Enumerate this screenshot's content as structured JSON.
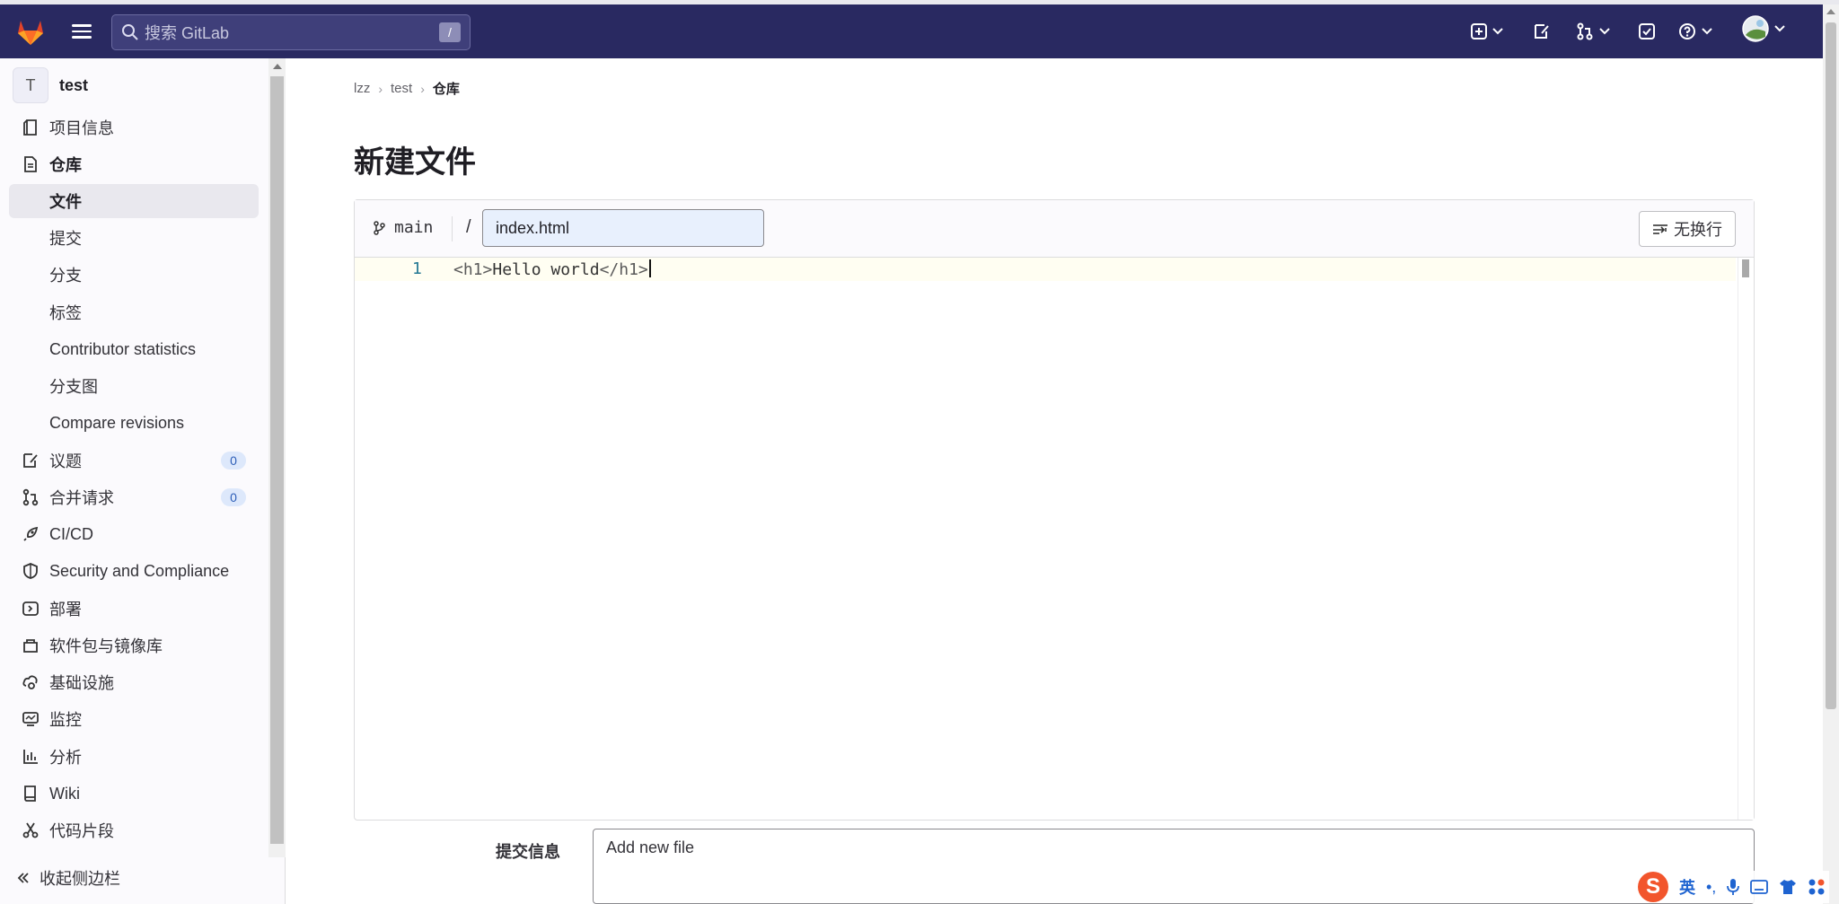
{
  "search": {
    "placeholder": "搜索 GitLab",
    "shortcut": "/"
  },
  "sidebar": {
    "project_avatar": "T",
    "project_name": "test",
    "items": [
      {
        "label": "项目信息",
        "icon": "project-info-icon"
      },
      {
        "label": "仓库",
        "icon": "document-icon"
      },
      {
        "label": "文件"
      },
      {
        "label": "提交"
      },
      {
        "label": "分支"
      },
      {
        "label": "标签"
      },
      {
        "label": "Contributor statistics"
      },
      {
        "label": "分支图"
      },
      {
        "label": "Compare revisions"
      },
      {
        "label": "议题",
        "icon": "issues-icon",
        "badge": "0"
      },
      {
        "label": "合并请求",
        "icon": "merge-request-icon",
        "badge": "0"
      },
      {
        "label": "CI/CD",
        "icon": "rocket-icon"
      },
      {
        "label": "Security and Compliance",
        "icon": "shield-icon"
      },
      {
        "label": "部署",
        "icon": "deployments-icon"
      },
      {
        "label": "软件包与镜像库",
        "icon": "package-icon"
      },
      {
        "label": "基础设施",
        "icon": "cloud-gear-icon"
      },
      {
        "label": "监控",
        "icon": "monitor-icon"
      },
      {
        "label": "分析",
        "icon": "chart-icon"
      },
      {
        "label": "Wiki",
        "icon": "book-icon"
      },
      {
        "label": "代码片段",
        "icon": "scissors-icon"
      }
    ],
    "collapse_label": "收起侧边栏"
  },
  "breadcrumb": {
    "items": [
      "lzz",
      "test",
      "仓库"
    ]
  },
  "page": {
    "title": "新建文件"
  },
  "editor": {
    "branch": "main",
    "separator": "/",
    "filename": "index.html",
    "wrap_label": "无换行",
    "line_number": "1",
    "code_open": "<h1>",
    "code_text": "Hello world",
    "code_close": "</h1>"
  },
  "commit": {
    "label": "提交信息",
    "value": "Add new file"
  },
  "ime": {
    "mode": "英",
    "punct": "•,"
  },
  "colors": {
    "topbar": "#292961",
    "accent": "#1f75cb",
    "badge_bg": "#dde8fb"
  }
}
